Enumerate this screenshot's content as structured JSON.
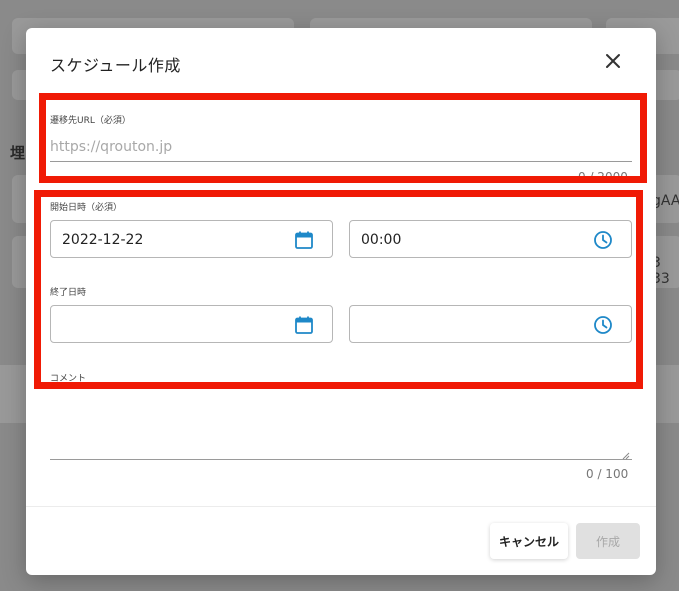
{
  "background": {
    "left_heading_fragment": "埋",
    "right_fragment_1": "gAA",
    "right_fragment_2": "3 33"
  },
  "modal": {
    "title": "スケジュール作成",
    "close_label": "×"
  },
  "url_field": {
    "label": "遷移先URL（必須）",
    "placeholder": "https://qrouton.jp",
    "value": "",
    "counter": "0 / 2000"
  },
  "start": {
    "label": "開始日時（必須）",
    "date_value": "2022-12-22",
    "time_value": "00:00"
  },
  "end": {
    "label": "終了日時",
    "date_value": "",
    "time_value": ""
  },
  "comment": {
    "label": "コメント",
    "value": "",
    "counter": "0 / 100"
  },
  "footer": {
    "cancel_label": "キャンセル",
    "create_label": "作成"
  },
  "colors": {
    "accent_icon": "#1e88c8",
    "highlight": "#f01a05"
  }
}
